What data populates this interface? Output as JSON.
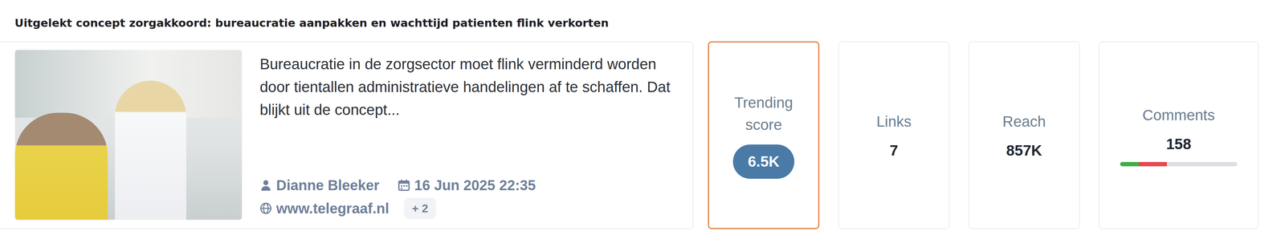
{
  "title": "Uitgelekt concept zorgakkoord: bureaucratie aanpakken en wachttijd patienten flink verkorten",
  "article": {
    "summary": "Bureaucratie in de zorgsector moet flink verminderd worden door tientallen administratieve handelingen af te schaffen. Dat blijkt uit de concept...",
    "author": "Dianne Bleeker",
    "date": "16 Jun 2025 22:35",
    "source": "www.telegraaf.nl",
    "extra_sources": "+ 2"
  },
  "stats": [
    {
      "label": "Trending score",
      "value": "6.5K",
      "kind": "badge",
      "selected": true,
      "segments": []
    },
    {
      "label": "Links",
      "value": "7",
      "kind": "plain",
      "selected": false,
      "segments": []
    },
    {
      "label": "Reach",
      "value": "857K",
      "kind": "plain",
      "selected": false,
      "segments": []
    },
    {
      "label": "Comments",
      "value": "158",
      "kind": "bar",
      "selected": false,
      "segments": [
        {
          "level": 0.16,
          "color": "#3cb043"
        },
        {
          "level": 0.24,
          "color": "#e5484d"
        }
      ]
    }
  ]
}
